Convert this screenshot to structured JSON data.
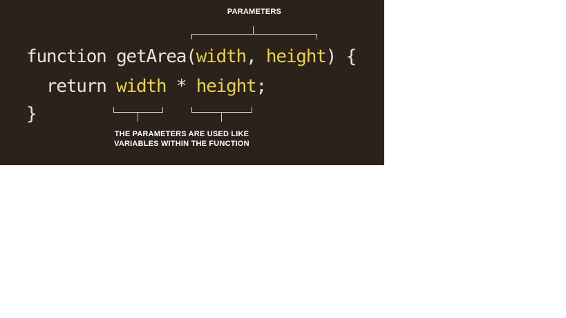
{
  "annotations": {
    "parameters_label": "PARAMETERS",
    "usage_line1": "THE PARAMETERS ARE USED LIKE",
    "usage_line2": "VARIABLES WITHIN THE FUNCTION"
  },
  "code": {
    "line1": {
      "prefix": "function getArea(",
      "param1": "width",
      "separator": ", ",
      "param2": "height",
      "suffix": ") {"
    },
    "line2": {
      "indent": "  ",
      "keyword": "return ",
      "param1": "width",
      "operator": " * ",
      "param2": "height",
      "suffix": ";"
    },
    "line3": {
      "text": "}"
    }
  },
  "colors": {
    "background": "#2c221c",
    "code_text": "#e9e4da",
    "parameter_highlight": "#e8d24a",
    "annotation_text": "#ffffff"
  }
}
